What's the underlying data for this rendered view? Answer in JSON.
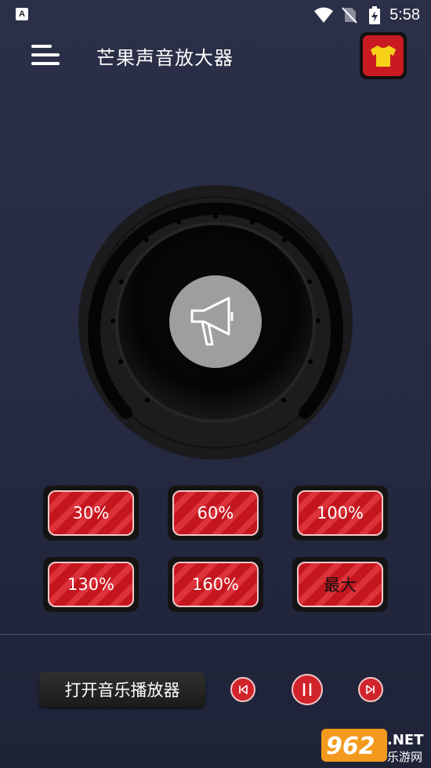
{
  "status_bar": {
    "time": "5:58",
    "icons": [
      "a-app-icon",
      "wifi-icon",
      "no-sim-icon",
      "battery-charging-icon"
    ]
  },
  "toolbar": {
    "menu_icon": "hamburger-menu-icon",
    "title": "芒果声音放大器",
    "theme_icon": "tshirt-icon"
  },
  "speaker": {
    "icon": "megaphone-icon"
  },
  "volume_presets": [
    {
      "label": "30%"
    },
    {
      "label": "60%"
    },
    {
      "label": "100%"
    },
    {
      "label": "130%"
    },
    {
      "label": "160%"
    },
    {
      "label": "最大"
    }
  ],
  "player": {
    "open_label": "打开音乐播放器",
    "prev_icon": "skip-previous-icon",
    "pause_icon": "pause-icon",
    "next_icon": "skip-next-icon"
  },
  "watermark": {
    "text": "962.NET",
    "subtext": "乐游网"
  },
  "colors": {
    "background": "#272c44",
    "accent_red": "#c91a22",
    "theme_icon": "#f7d118"
  }
}
